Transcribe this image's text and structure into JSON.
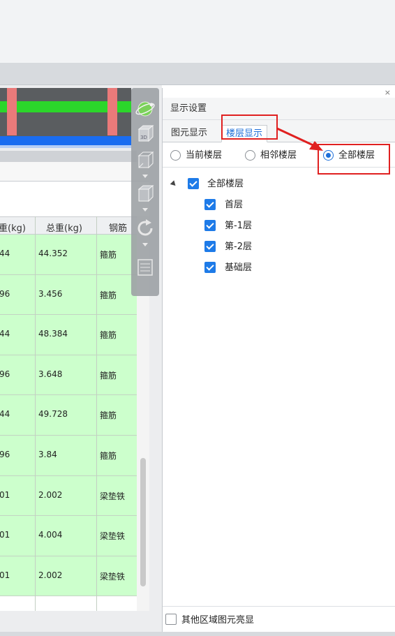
{
  "left_table": {
    "headers": [
      "重(kg)",
      "总重(kg)",
      "钢筋"
    ],
    "rows": [
      {
        "unit_weight": "44",
        "total_weight": "44.352",
        "rebar_type": "箍筋"
      },
      {
        "unit_weight": "96",
        "total_weight": "3.456",
        "rebar_type": "箍筋"
      },
      {
        "unit_weight": "44",
        "total_weight": "48.384",
        "rebar_type": "箍筋"
      },
      {
        "unit_weight": "96",
        "total_weight": "3.648",
        "rebar_type": "箍筋"
      },
      {
        "unit_weight": "44",
        "total_weight": "49.728",
        "rebar_type": "箍筋"
      },
      {
        "unit_weight": "96",
        "total_weight": "3.84",
        "rebar_type": "箍筋"
      },
      {
        "unit_weight": "01",
        "total_weight": "2.002",
        "rebar_type": "梁垫铁"
      },
      {
        "unit_weight": "01",
        "total_weight": "4.004",
        "rebar_type": "梁垫铁"
      },
      {
        "unit_weight": "01",
        "total_weight": "2.002",
        "rebar_type": "梁垫铁"
      }
    ]
  },
  "view_tool": {
    "view_3d_label": "3D"
  },
  "display_settings": {
    "title": "显示设置",
    "close_label": "×",
    "tabs": [
      {
        "label": "图元显示",
        "active": false
      },
      {
        "label": "楼层显示",
        "active": true
      }
    ],
    "floor_scope": {
      "options": [
        "当前楼层",
        "相邻楼层",
        "全部楼层"
      ],
      "selected": "全部楼层"
    },
    "tree": {
      "root": {
        "label": "全部楼层",
        "checked": true
      },
      "children": [
        {
          "label": "首层",
          "checked": true
        },
        {
          "label": "第-1层",
          "checked": true
        },
        {
          "label": "第-2层",
          "checked": true
        },
        {
          "label": "基础层",
          "checked": true
        }
      ]
    },
    "highlight_other_areas": {
      "label": "其他区域图元亮显",
      "checked": false
    }
  },
  "colors": {
    "accent": "#1e7be8",
    "annotation_red": "#e02020",
    "row_green": "#ccffcc",
    "beam_green": "#2bd62b",
    "beam_blue": "#1a6cf0",
    "column_pink": "#ea7a7a"
  }
}
